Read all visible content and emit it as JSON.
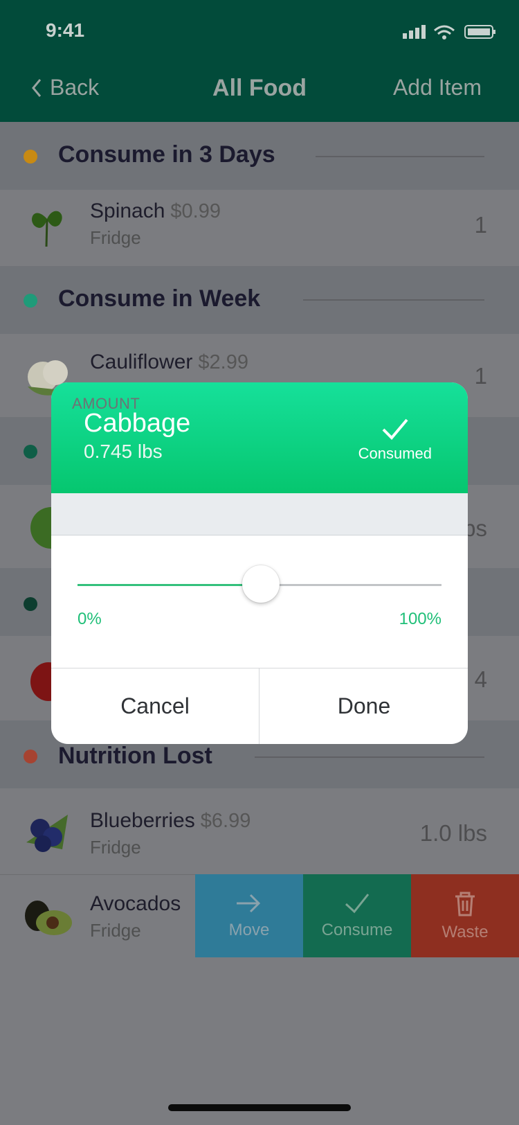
{
  "status": {
    "time": "9:41"
  },
  "nav": {
    "back": "Back",
    "title": "All Food",
    "add": "Add Item"
  },
  "sections": [
    {
      "title": "Consume in 3 Days",
      "color": "#c88a13"
    },
    {
      "title": "Consume in Week",
      "color": "#1f9b79"
    },
    {
      "title": "Nutrition Lost",
      "color": "#a64331"
    }
  ],
  "items": [
    {
      "name": "Spinach",
      "price": "$0.99",
      "location": "Fridge",
      "qty": "1"
    },
    {
      "name": "Cauliflower",
      "price": "$2.99",
      "qty": "1"
    },
    {
      "partial_qty_1": "bs",
      "partial_qty_2": "4"
    },
    {
      "name": "Blueberries",
      "price": "$6.99",
      "location": "Fridge",
      "qty": "1.0 lbs"
    },
    {
      "name": "Avocados",
      "location": "Fridge"
    }
  ],
  "swipe_actions": {
    "move": "Move",
    "consume": "Consume",
    "waste": "Waste"
  },
  "modal": {
    "title": "Cabbage",
    "weight": "0.745 lbs",
    "consumed_label": "Consumed",
    "section_label": "AMOUNT",
    "slider": {
      "value_fraction": 0.5,
      "min_label": "0%",
      "max_label": "100%"
    },
    "cancel": "Cancel",
    "done": "Done"
  },
  "colors": {
    "header": "#024b3a",
    "accent": "#06c66f",
    "move": "#2f7b98",
    "consume": "#136b50",
    "waste": "#8e2f20"
  }
}
